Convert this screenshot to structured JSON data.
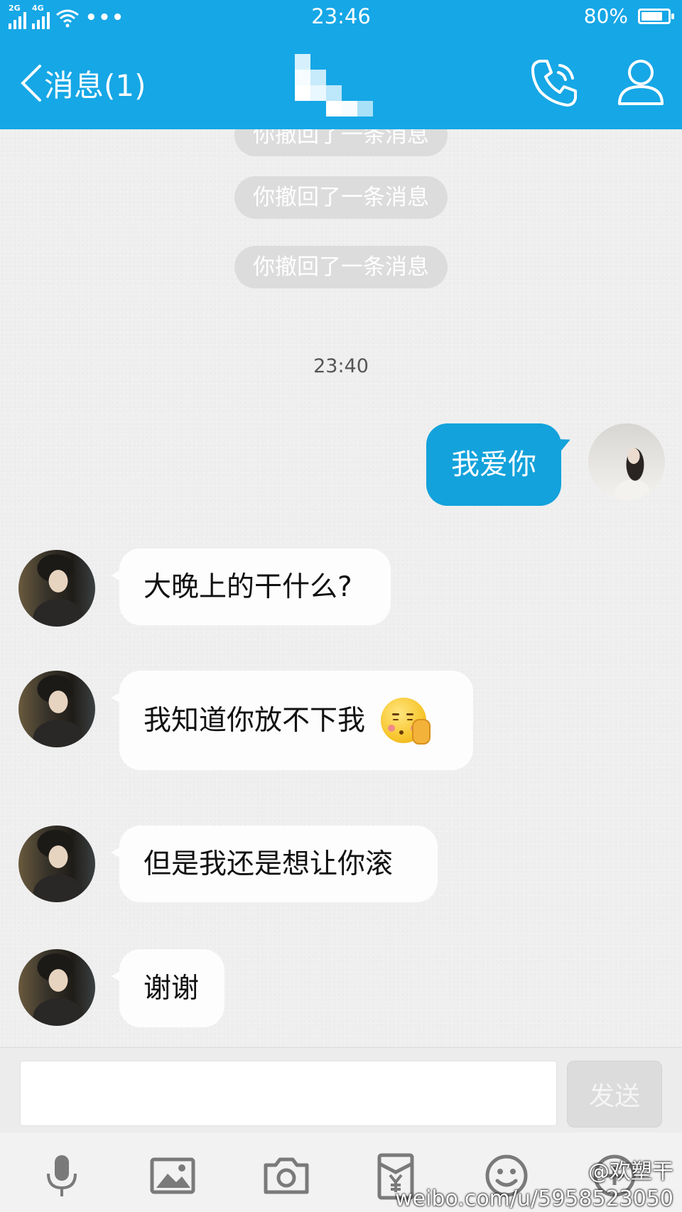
{
  "status_bar": {
    "network_2g": "2G",
    "network_4g": "4G",
    "more": "•••",
    "time": "23:46",
    "battery": "80%",
    "battery_level": 0.8
  },
  "nav": {
    "back_label": "消息(1)",
    "contact_name_pixelated": true,
    "icons": [
      "phone-icon",
      "person-icon"
    ]
  },
  "colors": {
    "header": "#16a7e6",
    "outgoing_bubble": "#13a2db",
    "incoming_bubble": "#fdfdfd"
  },
  "chat": {
    "system_messages": [
      "你撤回了一条消息",
      "你撤回了一条消息",
      "你撤回了一条消息"
    ],
    "timestamp": "23:40",
    "outgoing": [
      {
        "text": "我爱你"
      }
    ],
    "incoming": [
      {
        "text": "大晚上的干什么?"
      },
      {
        "text": "我知道你放不下我",
        "emoji": "shy-pick-nose-emoji"
      },
      {
        "text": "但是我还是想让你滚"
      },
      {
        "text": "谢谢"
      }
    ]
  },
  "composer": {
    "input_value": "",
    "send_label": "发送"
  },
  "toolbar": {
    "icons": [
      "microphone-icon",
      "image-icon",
      "camera-icon",
      "red-packet-icon",
      "emoji-icon",
      "plus-icon"
    ]
  },
  "watermark": {
    "line1": "@欢塑干",
    "line2": "weibo.com/u/5958523050"
  }
}
